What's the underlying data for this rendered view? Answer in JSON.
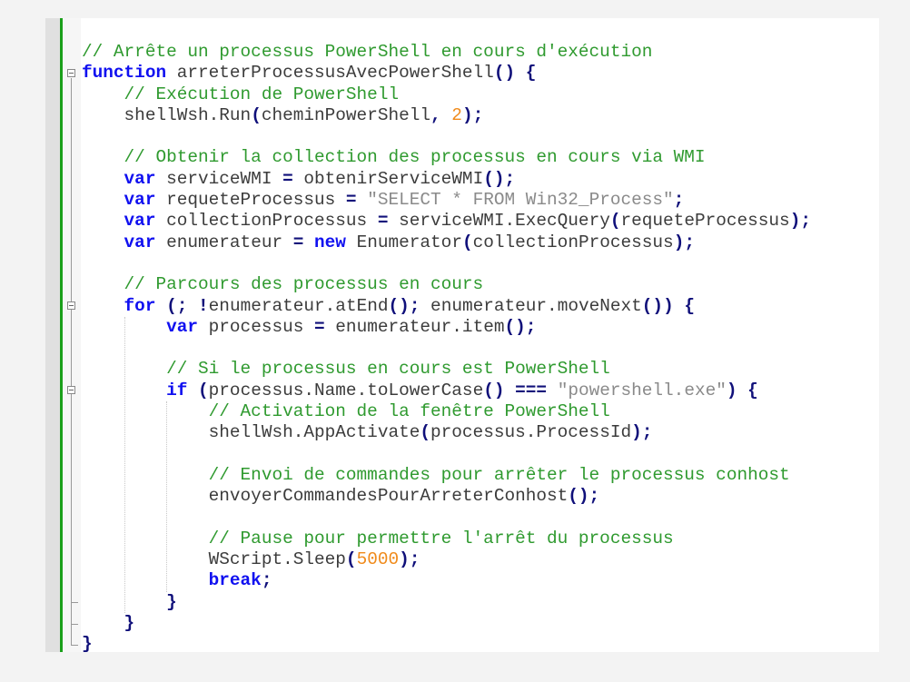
{
  "editor": {
    "language": "JavaScript",
    "colors": {
      "comment": "#2f9a2f",
      "keyword": "#1010f0",
      "operator": "#10107a",
      "string": "#8a8a8a",
      "number": "#f08a1a",
      "text": "#3c3c3c",
      "change_bar": "#1aa01a"
    },
    "lines": [
      [
        [
          "c",
          "// Arrête un processus PowerShell en cours d'exécution"
        ]
      ],
      [
        [
          "k",
          "function"
        ],
        [
          "t",
          " arreterProcessusAvecPowerShell"
        ],
        [
          "o",
          "()"
        ],
        [
          "t",
          " "
        ],
        [
          "o",
          "{"
        ]
      ],
      [
        [
          "t",
          "    "
        ],
        [
          "c",
          "// Exécution de PowerShell"
        ]
      ],
      [
        [
          "t",
          "    shellWsh.Run"
        ],
        [
          "o",
          "("
        ],
        [
          "t",
          "cheminPowerShell"
        ],
        [
          "o",
          ","
        ],
        [
          "t",
          " "
        ],
        [
          "n",
          "2"
        ],
        [
          "o",
          ");"
        ]
      ],
      [],
      [
        [
          "t",
          "    "
        ],
        [
          "c",
          "// Obtenir la collection des processus en cours via WMI"
        ]
      ],
      [
        [
          "t",
          "    "
        ],
        [
          "k",
          "var"
        ],
        [
          "t",
          " serviceWMI "
        ],
        [
          "o",
          "="
        ],
        [
          "t",
          " obtenirServiceWMI"
        ],
        [
          "o",
          "();"
        ]
      ],
      [
        [
          "t",
          "    "
        ],
        [
          "k",
          "var"
        ],
        [
          "t",
          " requeteProcessus "
        ],
        [
          "o",
          "="
        ],
        [
          "t",
          " "
        ],
        [
          "s",
          "\"SELECT * FROM Win32_Process\""
        ],
        [
          "o",
          ";"
        ]
      ],
      [
        [
          "t",
          "    "
        ],
        [
          "k",
          "var"
        ],
        [
          "t",
          " collectionProcessus "
        ],
        [
          "o",
          "="
        ],
        [
          "t",
          " serviceWMI.ExecQuery"
        ],
        [
          "o",
          "("
        ],
        [
          "t",
          "requeteProcessus"
        ],
        [
          "o",
          ");"
        ]
      ],
      [
        [
          "t",
          "    "
        ],
        [
          "k",
          "var"
        ],
        [
          "t",
          " enumerateur "
        ],
        [
          "o",
          "="
        ],
        [
          "t",
          " "
        ],
        [
          "k",
          "new"
        ],
        [
          "t",
          " Enumerator"
        ],
        [
          "o",
          "("
        ],
        [
          "t",
          "collectionProcessus"
        ],
        [
          "o",
          ");"
        ]
      ],
      [],
      [
        [
          "t",
          "    "
        ],
        [
          "c",
          "// Parcours des processus en cours"
        ]
      ],
      [
        [
          "t",
          "    "
        ],
        [
          "k",
          "for"
        ],
        [
          "t",
          " "
        ],
        [
          "o",
          "(;"
        ],
        [
          "t",
          " "
        ],
        [
          "o",
          "!"
        ],
        [
          "t",
          "enumerateur.atEnd"
        ],
        [
          "o",
          "();"
        ],
        [
          "t",
          " enumerateur.moveNext"
        ],
        [
          "o",
          "())"
        ],
        [
          "t",
          " "
        ],
        [
          "o",
          "{"
        ]
      ],
      [
        [
          "t",
          "        "
        ],
        [
          "k",
          "var"
        ],
        [
          "t",
          " processus "
        ],
        [
          "o",
          "="
        ],
        [
          "t",
          " enumerateur.item"
        ],
        [
          "o",
          "();"
        ]
      ],
      [],
      [
        [
          "t",
          "        "
        ],
        [
          "c",
          "// Si le processus en cours est PowerShell"
        ]
      ],
      [
        [
          "t",
          "        "
        ],
        [
          "k",
          "if"
        ],
        [
          "t",
          " "
        ],
        [
          "o",
          "("
        ],
        [
          "t",
          "processus.Name.toLowerCase"
        ],
        [
          "o",
          "()"
        ],
        [
          "t",
          " "
        ],
        [
          "o",
          "==="
        ],
        [
          "t",
          " "
        ],
        [
          "s",
          "\"powershell.exe\""
        ],
        [
          "o",
          ")"
        ],
        [
          "t",
          " "
        ],
        [
          "o",
          "{"
        ]
      ],
      [
        [
          "t",
          "            "
        ],
        [
          "c",
          "// Activation de la fenêtre PowerShell"
        ]
      ],
      [
        [
          "t",
          "            shellWsh.AppActivate"
        ],
        [
          "o",
          "("
        ],
        [
          "t",
          "processus.ProcessId"
        ],
        [
          "o",
          ");"
        ]
      ],
      [],
      [
        [
          "t",
          "            "
        ],
        [
          "c",
          "// Envoi de commandes pour arrêter le processus conhost"
        ]
      ],
      [
        [
          "t",
          "            envoyerCommandesPourArreterConhost"
        ],
        [
          "o",
          "();"
        ]
      ],
      [],
      [
        [
          "t",
          "            "
        ],
        [
          "c",
          "// Pause pour permettre l'arrêt du processus"
        ]
      ],
      [
        [
          "t",
          "            WScript.Sleep"
        ],
        [
          "o",
          "("
        ],
        [
          "n",
          "5000"
        ],
        [
          "o",
          ");"
        ]
      ],
      [
        [
          "t",
          "            "
        ],
        [
          "k",
          "break"
        ],
        [
          "o",
          ";"
        ]
      ],
      [
        [
          "t",
          "        "
        ],
        [
          "o",
          "}"
        ]
      ],
      [
        [
          "t",
          "    "
        ],
        [
          "o",
          "}"
        ]
      ],
      [
        [
          "o",
          "}"
        ]
      ]
    ]
  }
}
